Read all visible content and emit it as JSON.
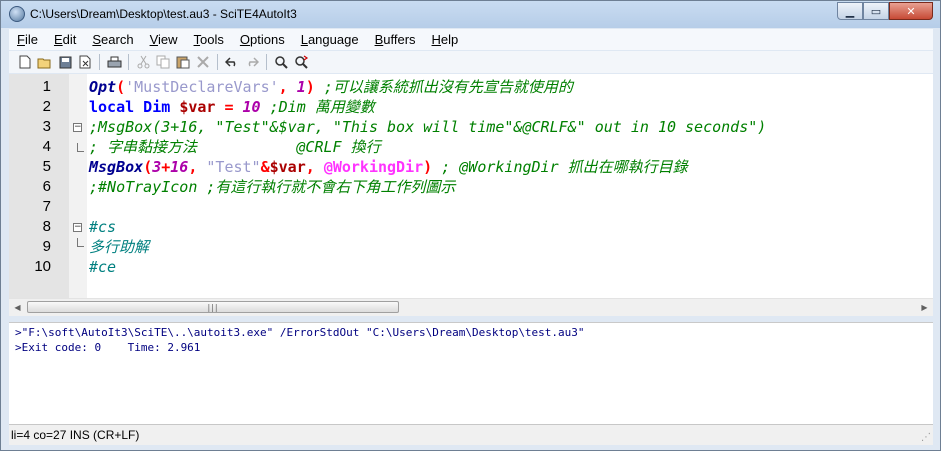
{
  "window": {
    "title": "C:\\Users\\Dream\\Desktop\\test.au3 - SciTE4AutoIt3"
  },
  "menu": [
    {
      "accel": "F",
      "rest": "ile"
    },
    {
      "accel": "E",
      "rest": "dit"
    },
    {
      "accel": "S",
      "rest": "earch"
    },
    {
      "accel": "V",
      "rest": "iew"
    },
    {
      "accel": "T",
      "rest": "ools"
    },
    {
      "accel": "O",
      "rest": "ptions"
    },
    {
      "accel": "L",
      "rest": "anguage"
    },
    {
      "accel": "B",
      "rest": "uffers"
    },
    {
      "accel": "H",
      "rest": "elp"
    }
  ],
  "toolbar_icons": [
    "new-file",
    "open-folder",
    "save",
    "close-file",
    "print",
    "cut",
    "copy",
    "paste",
    "delete",
    "undo",
    "redo",
    "find",
    "replace"
  ],
  "caption_glyphs": {
    "minimize": "▁",
    "maximize": "▭",
    "close": "✕"
  },
  "editor": {
    "line_numbers": [
      "1",
      "2",
      "3",
      "4",
      "5",
      "6",
      "7",
      "8",
      "9",
      "10"
    ],
    "lines": [
      [
        {
          "t": "Opt",
          "c": "func"
        },
        {
          "t": "(",
          "c": "op"
        },
        {
          "t": "'MustDeclareVars'",
          "c": "str"
        },
        {
          "t": ", ",
          "c": "op"
        },
        {
          "t": "1",
          "c": "num"
        },
        {
          "t": ") ",
          "c": "op"
        },
        {
          "t": ";可以讓系統抓出沒有先宣告就使用的",
          "c": "comment"
        }
      ],
      [
        {
          "t": "local Dim ",
          "c": "kw"
        },
        {
          "t": "$var",
          "c": "var"
        },
        {
          "t": " = ",
          "c": "op"
        },
        {
          "t": "10",
          "c": "num"
        },
        {
          "t": " ;Dim 萬用變數",
          "c": "comment"
        }
      ],
      [
        {
          "t": ";MsgBox(3+16, \"Test\"&$var, \"This box will time\"&@CRLF&\" out in 10 seconds\")",
          "c": "comment"
        }
      ],
      [
        {
          "t": "; 字串黏接方法           @CRLF 換行",
          "c": "comment"
        }
      ],
      [
        {
          "t": "MsgBox",
          "c": "func"
        },
        {
          "t": "(",
          "c": "op"
        },
        {
          "t": "3",
          "c": "num"
        },
        {
          "t": "+",
          "c": "op"
        },
        {
          "t": "16",
          "c": "num"
        },
        {
          "t": ", ",
          "c": "op"
        },
        {
          "t": "\"Test\"",
          "c": "str"
        },
        {
          "t": "&",
          "c": "op"
        },
        {
          "t": "$var",
          "c": "var"
        },
        {
          "t": ", ",
          "c": "op"
        },
        {
          "t": "@WorkingDir",
          "c": "macro"
        },
        {
          "t": ") ",
          "c": "op"
        },
        {
          "t": "; @WorkingDir 抓出在哪執行目錄",
          "c": "comment"
        }
      ],
      [
        {
          "t": ";#NoTrayIcon ;有這行執行就不會右下角工作列圖示",
          "c": "comment"
        }
      ],
      [],
      [
        {
          "t": "#cs",
          "c": "region"
        }
      ],
      [
        {
          "t": "多行助解",
          "c": "region"
        }
      ],
      [
        {
          "t": "#ce",
          "c": "region"
        }
      ]
    ]
  },
  "hscroll": {
    "grip": "|||"
  },
  "output": {
    "lines": [
      ">\"F:\\soft\\AutoIt3\\SciTE\\..\\autoit3.exe\" /ErrorStdOut \"C:\\Users\\Dream\\Desktop\\test.au3\"",
      ">Exit code: 0    Time: 2.961"
    ]
  },
  "status": {
    "text": "li=4 co=27 INS (CR+LF)"
  }
}
